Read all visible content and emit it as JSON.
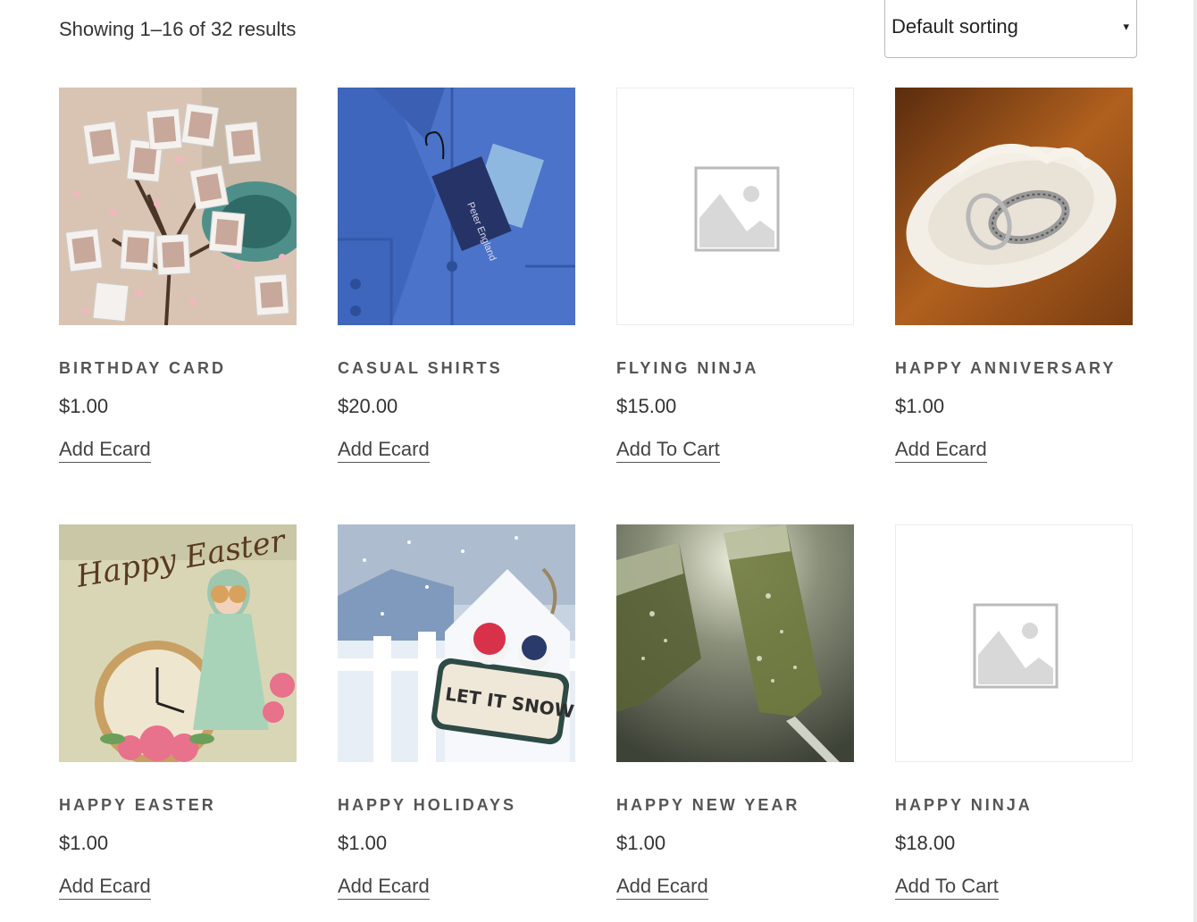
{
  "toolbar": {
    "result_count": "Showing 1–16 of 32 results",
    "sort_selected": "Default sorting",
    "caret": "▾"
  },
  "products": [
    {
      "name": "Birthday Card",
      "price": "$1.00",
      "action": "Add Ecard",
      "image": "birthday-photos-tree"
    },
    {
      "name": "Casual Shirts",
      "price": "$20.00",
      "action": "Add Ecard",
      "image": "blue-shirt-with-tag"
    },
    {
      "name": "Flying Ninja",
      "price": "$15.00",
      "action": "Add To Cart",
      "image": "placeholder-image-icon"
    },
    {
      "name": "Happy Anniversary",
      "price": "$1.00",
      "action": "Add Ecard",
      "image": "rings-on-dish"
    },
    {
      "name": "Happy Easter",
      "price": "$1.00",
      "action": "Add Ecard",
      "image": "vintage-easter-girl-clock"
    },
    {
      "name": "Happy Holidays",
      "price": "$1.00",
      "action": "Add Ecard",
      "image": "let-it-snow-sign"
    },
    {
      "name": "Happy New Year",
      "price": "$1.00",
      "action": "Add Ecard",
      "image": "champagne-glasses"
    },
    {
      "name": "Happy Ninja",
      "price": "$18.00",
      "action": "Add To Cart",
      "image": "placeholder-image-icon"
    }
  ],
  "image_texts": {
    "shirt_tag": "Peter England",
    "easter_script": "Happy Easter",
    "snow_sign": "LET IT SNOW"
  }
}
